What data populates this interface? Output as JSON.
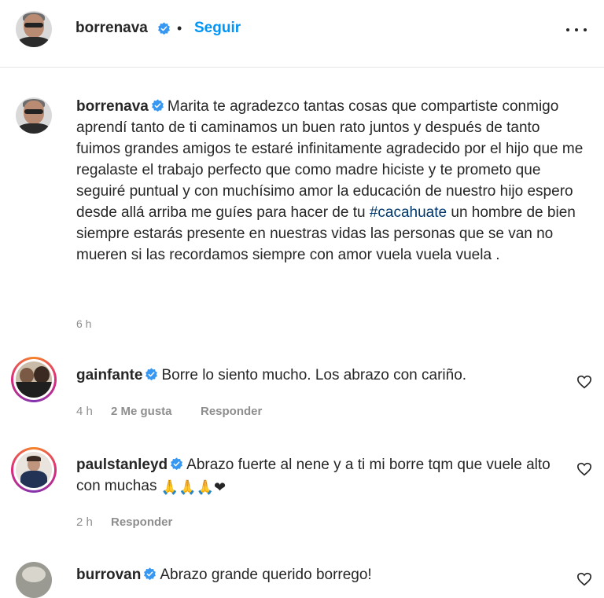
{
  "header": {
    "username": "borrenava",
    "separator": "•",
    "follow_label": "Seguir"
  },
  "caption": {
    "username": "borrenava",
    "text_before": "Marita te agradezco tantas cosas que compartiste conmigo aprendí tanto de ti caminamos un buen rato juntos y después de tanto fuimos grandes amigos te estaré infinitamente agradecido por el hijo que me regalaste el trabajo perfecto que como madre hiciste y te prometo que seguiré puntual y con muchísimo amor la educación de nuestro hijo espero desde allá arriba me guíes para hacer de tu",
    "hashtag": "#cacahuate",
    "text_after": "un hombre de bien siempre estarás presente en nuestras vidas las personas que se van no mueren si las recordamos siempre con amor vuela vuela vuela .",
    "time": "6 h"
  },
  "comments": [
    {
      "username": "gainfante",
      "text": "Borre lo siento mucho. Los abrazo con cariño.",
      "time": "4 h",
      "likes": "2 Me gusta",
      "reply": "Responder"
    },
    {
      "username": "paulstanleyd",
      "text": "Abrazo fuerte al nene y a ti mi borre tqm que vuele alto con muchas",
      "emojis": "🙏🙏🙏❤",
      "time": "2 h",
      "reply": "Responder"
    },
    {
      "username": "burrovan",
      "text": "Abrazo grande querido borrego!"
    }
  ],
  "colors": {
    "link_blue": "#0095f6",
    "hashtag_blue": "#00376b",
    "verified_blue": "#3897f0",
    "muted_gray": "#8e8e8e"
  },
  "icons": [
    "verified-badge-icon",
    "more-options-icon",
    "heart-icon"
  ]
}
